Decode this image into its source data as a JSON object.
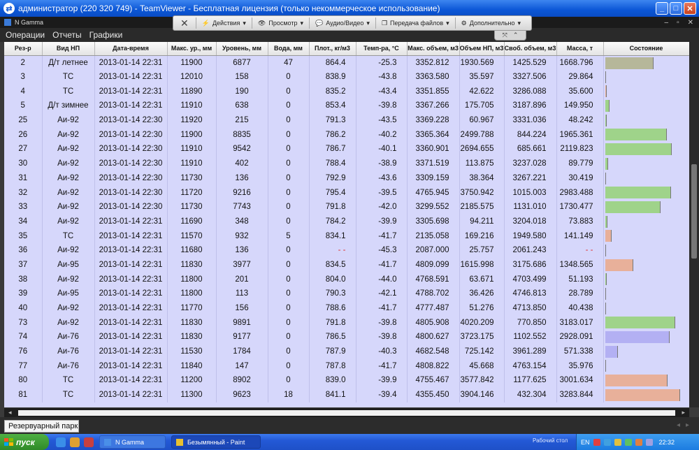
{
  "window": {
    "title": "администратор (220 320 749) - TeamViewer - Бесплатная лицензия (только некоммерческое использование)"
  },
  "app": {
    "title": "N Gamma"
  },
  "menu": [
    "Операции",
    "Отчеты",
    "Графики"
  ],
  "tv_toolbar": {
    "items": [
      "Действия",
      "Просмотр",
      "Аудио/Видео",
      "Передача файлов",
      "Дополнительно"
    ]
  },
  "columns": [
    "Рез-р",
    "Вид НП",
    "Дата-время",
    "Макс. ур., мм",
    "Уровень, мм",
    "Вода, мм",
    "Плот., кг/м3",
    "Темп-ра, °С",
    "Макс. объем, м3",
    "Объем НП, м3",
    "Своб. объем, м3",
    "Масса, т",
    "Состояние"
  ],
  "rows": [
    {
      "tank": "2",
      "product": "Д/т летнее",
      "datetime": "2013-01-14 22:31",
      "max_level": "11900",
      "level": "6877",
      "water": "47",
      "density": "864.4",
      "temp": "-25.3",
      "max_vol": "3352.812",
      "vol": "1930.569",
      "free_vol": "1425.529",
      "mass": "1668.796",
      "fill": 0.576,
      "color": "#b6b79a"
    },
    {
      "tank": "3",
      "product": "ТС",
      "datetime": "2013-01-14 22:31",
      "max_level": "12010",
      "level": "158",
      "water": "0",
      "density": "838.9",
      "temp": "-43.8",
      "max_vol": "3363.580",
      "vol": "35.597",
      "free_vol": "3327.506",
      "mass": "29.864",
      "fill": 0.011,
      "color": "#e8b09a"
    },
    {
      "tank": "4",
      "product": "ТС",
      "datetime": "2013-01-14 22:31",
      "max_level": "11890",
      "level": "190",
      "water": "0",
      "density": "835.2",
      "temp": "-43.4",
      "max_vol": "3351.855",
      "vol": "42.622",
      "free_vol": "3286.088",
      "mass": "35.600",
      "fill": 0.013,
      "color": "#e8b09a"
    },
    {
      "tank": "5",
      "product": "Д/т зимнее",
      "datetime": "2013-01-14 22:31",
      "max_level": "11910",
      "level": "638",
      "water": "0",
      "density": "853.4",
      "temp": "-39.8",
      "max_vol": "3367.266",
      "vol": "175.705",
      "free_vol": "3187.896",
      "mass": "149.950",
      "fill": 0.052,
      "color": "#9fd38a"
    },
    {
      "tank": "25",
      "product": "Аи-92",
      "datetime": "2013-01-14 22:30",
      "max_level": "11920",
      "level": "215",
      "water": "0",
      "density": "791.3",
      "temp": "-43.5",
      "max_vol": "3369.228",
      "vol": "60.967",
      "free_vol": "3331.036",
      "mass": "48.242",
      "fill": 0.018,
      "color": "#9fd38a"
    },
    {
      "tank": "26",
      "product": "Аи-92",
      "datetime": "2013-01-14 22:30",
      "max_level": "11900",
      "level": "8835",
      "water": "0",
      "density": "786.2",
      "temp": "-40.2",
      "max_vol": "3365.364",
      "vol": "2499.788",
      "free_vol": "844.224",
      "mass": "1965.361",
      "fill": 0.743,
      "color": "#9fd38a"
    },
    {
      "tank": "27",
      "product": "Аи-92",
      "datetime": "2013-01-14 22:30",
      "max_level": "11910",
      "level": "9542",
      "water": "0",
      "density": "786.7",
      "temp": "-40.1",
      "max_vol": "3360.901",
      "vol": "2694.655",
      "free_vol": "685.661",
      "mass": "2119.823",
      "fill": 0.802,
      "color": "#9fd38a"
    },
    {
      "tank": "30",
      "product": "Аи-92",
      "datetime": "2013-01-14 22:30",
      "max_level": "11910",
      "level": "402",
      "water": "0",
      "density": "788.4",
      "temp": "-38.9",
      "max_vol": "3371.519",
      "vol": "113.875",
      "free_vol": "3237.028",
      "mass": "89.779",
      "fill": 0.034,
      "color": "#9fd38a"
    },
    {
      "tank": "31",
      "product": "Аи-92",
      "datetime": "2013-01-14 22:30",
      "max_level": "11730",
      "level": "136",
      "water": "0",
      "density": "792.9",
      "temp": "-43.6",
      "max_vol": "3309.159",
      "vol": "38.364",
      "free_vol": "3267.221",
      "mass": "30.419",
      "fill": 0.012,
      "color": "#9fd38a"
    },
    {
      "tank": "32",
      "product": "Аи-92",
      "datetime": "2013-01-14 22:30",
      "max_level": "11720",
      "level": "9216",
      "water": "0",
      "density": "795.4",
      "temp": "-39.5",
      "max_vol": "4765.945",
      "vol": "3750.942",
      "free_vol": "1015.003",
      "mass": "2983.488",
      "fill": 0.787,
      "color": "#9fd38a"
    },
    {
      "tank": "33",
      "product": "Аи-92",
      "datetime": "2013-01-14 22:30",
      "max_level": "11730",
      "level": "7743",
      "water": "0",
      "density": "791.8",
      "temp": "-42.0",
      "max_vol": "3299.552",
      "vol": "2185.575",
      "free_vol": "1131.010",
      "mass": "1730.477",
      "fill": 0.662,
      "color": "#9fd38a"
    },
    {
      "tank": "34",
      "product": "Аи-92",
      "datetime": "2013-01-14 22:31",
      "max_level": "11690",
      "level": "348",
      "water": "0",
      "density": "784.2",
      "temp": "-39.9",
      "max_vol": "3305.698",
      "vol": "94.211",
      "free_vol": "3204.018",
      "mass": "73.883",
      "fill": 0.029,
      "color": "#9fd38a"
    },
    {
      "tank": "35",
      "product": "ТС",
      "datetime": "2013-01-14 22:31",
      "max_level": "11570",
      "level": "932",
      "water": "5",
      "density": "834.1",
      "temp": "-41.7",
      "max_vol": "2135.058",
      "vol": "169.216",
      "free_vol": "1949.580",
      "mass": "141.149",
      "fill": 0.079,
      "color": "#e8b09a"
    },
    {
      "tank": "36",
      "product": "Аи-92",
      "datetime": "2013-01-14 22:31",
      "max_level": "11680",
      "level": "136",
      "water": "0",
      "density": "- -",
      "temp": "-45.3",
      "max_vol": "2087.000",
      "vol": "25.757",
      "free_vol": "2061.243",
      "mass": "- -",
      "fill": 0.012,
      "color": "#9fd38a"
    },
    {
      "tank": "37",
      "product": "Аи-95",
      "datetime": "2013-01-14 22:31",
      "max_level": "11830",
      "level": "3977",
      "water": "0",
      "density": "834.5",
      "temp": "-41.7",
      "max_vol": "4809.099",
      "vol": "1615.998",
      "free_vol": "3175.686",
      "mass": "1348.565",
      "fill": 0.336,
      "color": "#e8b09a"
    },
    {
      "tank": "38",
      "product": "Аи-92",
      "datetime": "2013-01-14 22:31",
      "max_level": "11800",
      "level": "201",
      "water": "0",
      "density": "804.0",
      "temp": "-44.0",
      "max_vol": "4768.591",
      "vol": "63.671",
      "free_vol": "4703.499",
      "mass": "51.193",
      "fill": 0.013,
      "color": "#9fd38a"
    },
    {
      "tank": "39",
      "product": "Аи-95",
      "datetime": "2013-01-14 22:31",
      "max_level": "11800",
      "level": "113",
      "water": "0",
      "density": "790.3",
      "temp": "-42.1",
      "max_vol": "4788.702",
      "vol": "36.426",
      "free_vol": "4746.813",
      "mass": "28.789",
      "fill": 0.008,
      "color": "#e8b09a"
    },
    {
      "tank": "40",
      "product": "Аи-92",
      "datetime": "2013-01-14 22:31",
      "max_level": "11770",
      "level": "156",
      "water": "0",
      "density": "788.6",
      "temp": "-41.7",
      "max_vol": "4777.487",
      "vol": "51.276",
      "free_vol": "4713.850",
      "mass": "40.438",
      "fill": 0.011,
      "color": "#9fd38a"
    },
    {
      "tank": "73",
      "product": "Аи-92",
      "datetime": "2013-01-14 22:31",
      "max_level": "11830",
      "level": "9891",
      "water": "0",
      "density": "791.8",
      "temp": "-39.8",
      "max_vol": "4805.908",
      "vol": "4020.209",
      "free_vol": "770.850",
      "mass": "3183.017",
      "fill": 0.837,
      "color": "#9fd38a"
    },
    {
      "tank": "74",
      "product": "Аи-76",
      "datetime": "2013-01-14 22:31",
      "max_level": "11830",
      "level": "9177",
      "water": "0",
      "density": "786.5",
      "temp": "-39.8",
      "max_vol": "4800.627",
      "vol": "3723.175",
      "free_vol": "1102.552",
      "mass": "2928.091",
      "fill": 0.776,
      "color": "#b3b0f3"
    },
    {
      "tank": "76",
      "product": "Аи-76",
      "datetime": "2013-01-14 22:31",
      "max_level": "11530",
      "level": "1784",
      "water": "0",
      "density": "787.9",
      "temp": "-40.3",
      "max_vol": "4682.548",
      "vol": "725.142",
      "free_vol": "3961.289",
      "mass": "571.338",
      "fill": 0.155,
      "color": "#b3b0f3"
    },
    {
      "tank": "77",
      "product": "Аи-76",
      "datetime": "2013-01-14 22:31",
      "max_level": "11840",
      "level": "147",
      "water": "0",
      "density": "787.8",
      "temp": "-41.7",
      "max_vol": "4808.822",
      "vol": "45.668",
      "free_vol": "4763.154",
      "mass": "35.976",
      "fill": 0.009,
      "color": "#b3b0f3"
    },
    {
      "tank": "80",
      "product": "ТС",
      "datetime": "2013-01-14 22:31",
      "max_level": "11200",
      "level": "8902",
      "water": "0",
      "density": "839.0",
      "temp": "-39.9",
      "max_vol": "4755.467",
      "vol": "3577.842",
      "free_vol": "1177.625",
      "mass": "3001.634",
      "fill": 0.752,
      "color": "#e8b09a"
    },
    {
      "tank": "81",
      "product": "ТС",
      "datetime": "2013-01-14 22:31",
      "max_level": "11300",
      "level": "9623",
      "water": "18",
      "density": "841.1",
      "temp": "-39.4",
      "max_vol": "4355.450",
      "vol": "3904.146",
      "free_vol": "432.304",
      "mass": "3283.844",
      "fill": 0.896,
      "color": "#e8b09a"
    }
  ],
  "bottom_tab": "Резервуарный парк",
  "taskbar": {
    "start": "пуск",
    "tasks": [
      "N Gamma",
      "Безымянный - Paint"
    ],
    "desktop_label": "Рабочий стол",
    "lang": "EN",
    "clock": "22:32"
  }
}
